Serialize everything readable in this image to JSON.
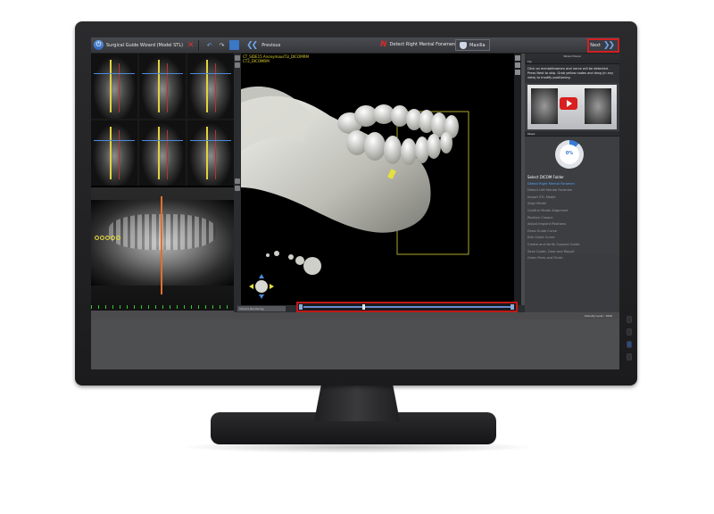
{
  "toolbar": {
    "wizard_title": "Surgical Guide Wizard (Model STL)",
    "previous_label": "Previous",
    "detect_label": "Detect Right Mental Foramen",
    "maxilla_label": "Maxilla",
    "next_label": "Next"
  },
  "view3d": {
    "label_line1": "CT_SIDE15 AnonymousTiz_DICOMRM",
    "label_line2": "CT2_DICOMRM"
  },
  "bottom_bar": {
    "render_mode": "Volume Rendering"
  },
  "right_panel": {
    "header": "Wizard Panel",
    "tip_section": "Tip",
    "tip_text": "Click on mentalforamen and nerve will be detected. Press Next to skip. Grab yellow nodes and drag (in any view) to modify positioning.",
    "steps_section": "Steps",
    "progress_text": "0%",
    "progress_value": 0.11,
    "steps": [
      "Select DICOM Folder",
      "Detect Right Mental Foramen",
      "Detect Left Mental Foramen",
      "Import STL Model",
      "Align Model",
      "Confirm Model Alignment",
      "Position Crowns",
      "Adjust Implant Positions",
      "Draw Guide Curve",
      "Edit Guide Curve",
      "Create and Verify Surgical Guide",
      "Save Guide, Case and Report",
      "Order Parts and Finish"
    ]
  },
  "footer": {
    "density_text": "Density Level : 1000"
  },
  "colors": {
    "accent_blue": "#5aa2ff",
    "highlight_red": "#d22020",
    "guide_yellow": "#e2d33c"
  }
}
